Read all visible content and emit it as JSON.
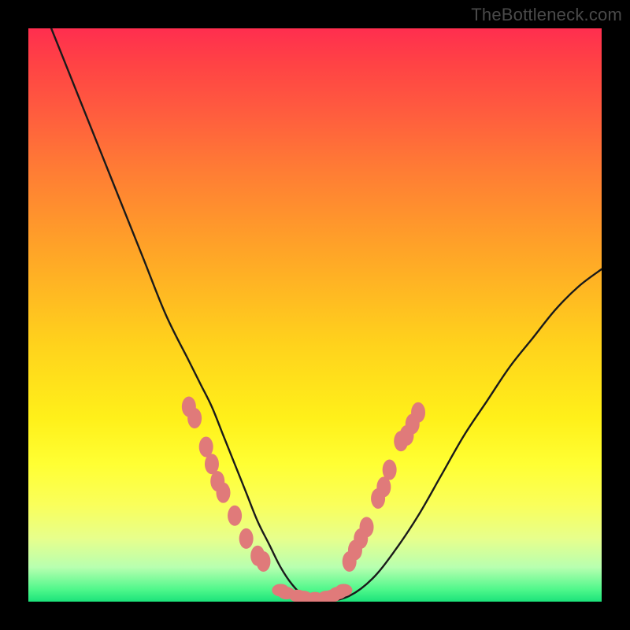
{
  "watermark": "TheBottleneck.com",
  "colors": {
    "background": "#000000",
    "curve_stroke": "#1a1a1a",
    "marker_fill": "#e07a7a",
    "gradient_top": "#ff2e4f",
    "gradient_bottom": "#1be27a"
  },
  "chart_data": {
    "type": "line",
    "title": "",
    "xlabel": "",
    "ylabel": "",
    "x_range": [
      0,
      100
    ],
    "y_range": [
      0,
      100
    ],
    "series": [
      {
        "name": "bottleneck-curve",
        "x": [
          4,
          8,
          12,
          16,
          20,
          24,
          28,
          30,
          32,
          34,
          36,
          38,
          40,
          42,
          44,
          46,
          48,
          50,
          52,
          56,
          60,
          64,
          68,
          72,
          76,
          80,
          84,
          88,
          92,
          96,
          100
        ],
        "y": [
          100,
          90,
          80,
          70,
          60,
          50,
          42,
          38,
          34,
          29,
          24,
          19,
          14,
          10,
          6,
          3,
          1,
          0,
          0,
          1,
          4,
          9,
          15,
          22,
          29,
          35,
          41,
          46,
          51,
          55,
          58
        ]
      }
    ],
    "markers_left": [
      {
        "x": 28,
        "y": 34
      },
      {
        "x": 29,
        "y": 32
      },
      {
        "x": 31,
        "y": 27
      },
      {
        "x": 32,
        "y": 24
      },
      {
        "x": 33,
        "y": 21
      },
      {
        "x": 34,
        "y": 19
      },
      {
        "x": 36,
        "y": 15
      },
      {
        "x": 38,
        "y": 11
      },
      {
        "x": 40,
        "y": 8
      },
      {
        "x": 41,
        "y": 7
      }
    ],
    "markers_right": [
      {
        "x": 56,
        "y": 7
      },
      {
        "x": 57,
        "y": 9
      },
      {
        "x": 58,
        "y": 11
      },
      {
        "x": 59,
        "y": 13
      },
      {
        "x": 61,
        "y": 18
      },
      {
        "x": 62,
        "y": 20
      },
      {
        "x": 63,
        "y": 23
      },
      {
        "x": 65,
        "y": 28
      },
      {
        "x": 66,
        "y": 29
      },
      {
        "x": 67,
        "y": 31
      },
      {
        "x": 68,
        "y": 33
      }
    ],
    "markers_bottom": [
      {
        "x": 44,
        "y": 2
      },
      {
        "x": 45,
        "y": 1.5
      },
      {
        "x": 47,
        "y": 1
      },
      {
        "x": 48,
        "y": 0.8
      },
      {
        "x": 50,
        "y": 0.6
      },
      {
        "x": 52,
        "y": 0.8
      },
      {
        "x": 53,
        "y": 1
      },
      {
        "x": 54,
        "y": 1.5
      },
      {
        "x": 55,
        "y": 2
      }
    ]
  }
}
